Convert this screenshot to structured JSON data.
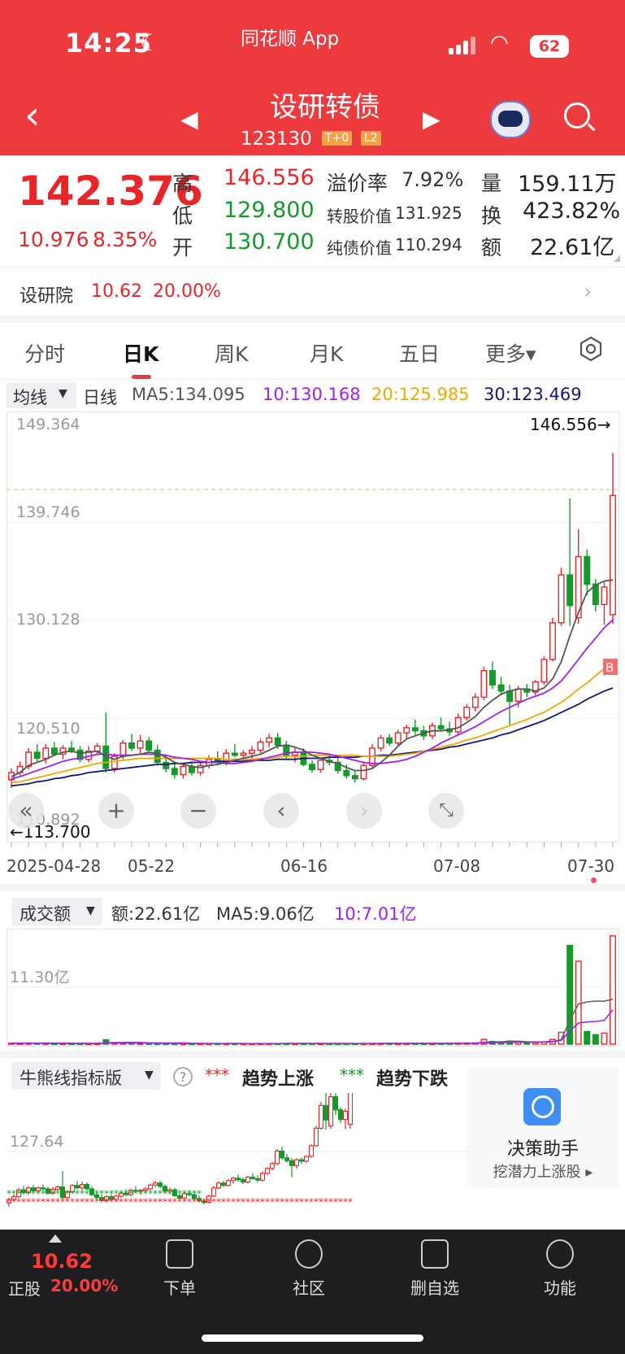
{
  "status_bar": {
    "time": "14:25",
    "app_name": "同花顺 App",
    "battery": "62"
  },
  "header": {
    "title": "设研转债",
    "code": "123130",
    "tag1": "T+0",
    "tag2": "L2"
  },
  "quote": {
    "price": "142.376",
    "change": "10.976",
    "change_pct": "8.35%",
    "high_label": "高",
    "high": "146.556",
    "low_label": "低",
    "low": "129.800",
    "open_label": "开",
    "open": "130.700",
    "premium_label": "溢价率",
    "premium": "7.92%",
    "conv_value_label": "转股价值",
    "conv_value": "131.925",
    "bond_value_label": "纯债价值",
    "bond_value": "110.294",
    "vol_label": "量",
    "vol": "159.11万",
    "turnover_label": "换",
    "turnover": "423.82%",
    "amount_label": "额",
    "amount": "22.61亿"
  },
  "related": {
    "name": "设研院",
    "price": "10.62",
    "pct": "20.00%"
  },
  "tabs": [
    {
      "label": "分时"
    },
    {
      "label": "日K"
    },
    {
      "label": "周K"
    },
    {
      "label": "月K"
    },
    {
      "label": "五日"
    },
    {
      "label": "更多▾"
    }
  ],
  "ma_row": {
    "button": "均线",
    "period": "日线",
    "ma5": "MA5:134.095",
    "ma10": "10:130.168",
    "ma20": "20:125.985",
    "ma30": "30:123.469",
    "colors": {
      "ma5": "#555555",
      "ma10": "#a020f0",
      "ma20": "#f0a800",
      "ma30": "#101880"
    }
  },
  "kchart_axis": {
    "y_ticks": [
      "149.364",
      "139.746",
      "130.128",
      "120.510",
      "110.892"
    ],
    "high_marker": "146.556→",
    "low_marker": "←113.700",
    "dates": [
      "2025-04-28",
      "05-22",
      "06-16",
      "07-08",
      "07-30"
    ],
    "b_marker": "B"
  },
  "volume": {
    "button": "成交额",
    "amount": "额:22.61亿",
    "ma5": "MA5:9.06亿",
    "ma10": "10:7.01亿",
    "y_tick": "11.30亿"
  },
  "indicator": {
    "button": "牛熊线指标版",
    "help": "?",
    "up_dots": "***",
    "up_label": "趋势上涨",
    "down_dots": "***",
    "down_label": "趋势下跌",
    "y_tick": "127.64"
  },
  "assistant": {
    "title": "决策助手",
    "subtitle": "挖潜力上涨股 ▸"
  },
  "bottom_bar": {
    "price": "10.62",
    "name": "正股",
    "pct": "20.00%",
    "items": [
      {
        "label": "下单"
      },
      {
        "label": "社区"
      },
      {
        "label": "删自选"
      },
      {
        "label": "功能"
      }
    ]
  },
  "chart_data": {
    "type": "candlestick",
    "ylim": [
      110.892,
      149.364
    ],
    "candles": [
      [
        114.5,
        115.6,
        113.7,
        115.2
      ],
      [
        115.2,
        116.3,
        114.9,
        115.8
      ],
      [
        115.8,
        117.6,
        115.5,
        117.2
      ],
      [
        117.2,
        118.0,
        116.3,
        116.6
      ],
      [
        116.6,
        118.0,
        116.1,
        117.6
      ],
      [
        117.6,
        118.2,
        116.9,
        117.0
      ],
      [
        117.0,
        117.9,
        116.5,
        117.6
      ],
      [
        117.6,
        118.3,
        117.1,
        117.4
      ],
      [
        117.4,
        117.8,
        116.2,
        116.5
      ],
      [
        116.5,
        117.8,
        116.2,
        117.3
      ],
      [
        117.3,
        118.1,
        116.9,
        117.8
      ],
      [
        117.8,
        121.1,
        115.2,
        115.6
      ],
      [
        115.6,
        117.1,
        115.2,
        116.8
      ],
      [
        116.8,
        118.4,
        116.5,
        118.1
      ],
      [
        118.1,
        119.0,
        117.3,
        117.6
      ],
      [
        117.6,
        118.9,
        117.0,
        118.3
      ],
      [
        118.3,
        118.7,
        117.2,
        117.4
      ],
      [
        117.4,
        117.9,
        115.9,
        116.2
      ],
      [
        116.2,
        116.9,
        115.2,
        115.6
      ],
      [
        115.6,
        116.3,
        114.6,
        115.0
      ],
      [
        115.0,
        116.1,
        114.6,
        115.8
      ],
      [
        115.8,
        116.3,
        114.9,
        115.2
      ],
      [
        115.2,
        116.2,
        114.9,
        115.9
      ],
      [
        115.9,
        116.9,
        115.6,
        116.5
      ],
      [
        116.5,
        117.3,
        115.9,
        116.2
      ],
      [
        116.2,
        117.5,
        115.9,
        117.1
      ],
      [
        117.1,
        118.0,
        116.7,
        116.9
      ],
      [
        116.9,
        117.4,
        116.2,
        117.1
      ],
      [
        117.1,
        117.8,
        116.5,
        117.4
      ],
      [
        117.4,
        118.5,
        117.1,
        118.2
      ],
      [
        118.2,
        119.0,
        117.7,
        118.6
      ],
      [
        118.6,
        119.1,
        117.5,
        117.9
      ],
      [
        117.9,
        118.3,
        116.6,
        116.9
      ],
      [
        116.9,
        117.6,
        116.2,
        117.2
      ],
      [
        117.2,
        117.6,
        115.8,
        116.0
      ],
      [
        116.0,
        116.4,
        115.2,
        115.5
      ],
      [
        115.5,
        116.7,
        115.2,
        116.4
      ],
      [
        116.4,
        117.1,
        115.9,
        116.2
      ],
      [
        116.2,
        116.6,
        115.1,
        115.4
      ],
      [
        115.4,
        116.0,
        114.6,
        114.9
      ],
      [
        114.9,
        115.4,
        114.2,
        114.6
      ],
      [
        114.6,
        116.2,
        114.4,
        115.9
      ],
      [
        115.9,
        118.0,
        115.7,
        117.6
      ],
      [
        117.6,
        118.9,
        117.3,
        118.6
      ],
      [
        118.6,
        119.0,
        117.8,
        118.1
      ],
      [
        118.1,
        119.4,
        117.9,
        119.1
      ],
      [
        119.1,
        119.9,
        118.5,
        119.6
      ],
      [
        119.6,
        120.4,
        118.9,
        119.3
      ],
      [
        119.3,
        119.8,
        118.4,
        118.8
      ],
      [
        118.8,
        120.1,
        118.5,
        119.8
      ],
      [
        119.8,
        120.6,
        119.3,
        119.5
      ],
      [
        119.5,
        120.2,
        118.8,
        119.2
      ],
      [
        119.2,
        121.0,
        118.9,
        120.6
      ],
      [
        120.6,
        121.9,
        120.3,
        121.6
      ],
      [
        121.6,
        123.0,
        121.2,
        122.6
      ],
      [
        122.6,
        125.6,
        122.3,
        125.2
      ],
      [
        125.2,
        126.1,
        123.4,
        123.8
      ],
      [
        123.8,
        124.6,
        122.8,
        123.2
      ],
      [
        123.2,
        123.8,
        119.8,
        122.2
      ],
      [
        122.2,
        123.7,
        121.6,
        123.4
      ],
      [
        123.4,
        123.9,
        122.6,
        123.1
      ],
      [
        123.1,
        124.3,
        122.8,
        124.1
      ],
      [
        124.1,
        126.6,
        123.8,
        126.3
      ],
      [
        126.3,
        130.4,
        126.1,
        129.9
      ],
      [
        129.9,
        135.3,
        129.6,
        134.6
      ],
      [
        134.6,
        142.1,
        129.6,
        131.6
      ],
      [
        130.4,
        139.1,
        129.8,
        136.4
      ],
      [
        136.4,
        137.1,
        132.6,
        133.7
      ],
      [
        133.7,
        134.2,
        131.0,
        131.7
      ],
      [
        131.7,
        133.9,
        129.7,
        133.4
      ],
      [
        130.7,
        146.6,
        129.8,
        142.4
      ]
    ],
    "ma5": [
      114.8,
      115.2,
      115.9,
      116.2,
      116.5,
      116.9,
      117.2,
      117.3,
      117.1,
      117.2,
      117.3,
      116.8,
      116.5,
      116.8,
      116.9,
      117.0,
      117.2,
      117.1,
      116.7,
      116.2,
      116.0,
      115.8,
      115.7,
      115.9,
      116.0,
      116.2,
      116.4,
      116.6,
      116.8,
      117.0,
      117.4,
      117.8,
      117.9,
      117.7,
      117.4,
      116.9,
      116.6,
      116.3,
      116.1,
      115.7,
      115.4,
      115.4,
      115.6,
      116.2,
      116.9,
      117.8,
      118.5,
      118.8,
      119.1,
      119.3,
      119.3,
      119.4,
      119.6,
      120.1,
      120.7,
      121.6,
      122.3,
      122.9,
      123.2,
      123.4,
      123.4,
      123.2,
      123.5,
      124.4,
      126.1,
      128.6,
      130.9,
      132.9,
      133.6,
      134.0,
      134.1
    ],
    "ma10": [
      114.6,
      114.8,
      115.1,
      115.4,
      115.7,
      116.0,
      116.3,
      116.5,
      116.6,
      116.8,
      117.0,
      117.0,
      116.9,
      116.9,
      116.9,
      117.0,
      117.0,
      117.0,
      116.9,
      116.7,
      116.6,
      116.5,
      116.3,
      116.2,
      116.2,
      116.1,
      116.1,
      116.2,
      116.3,
      116.5,
      116.7,
      116.9,
      117.1,
      117.2,
      117.2,
      117.2,
      117.1,
      117.0,
      116.8,
      116.6,
      116.4,
      116.2,
      116.1,
      116.1,
      116.2,
      116.3,
      116.5,
      116.8,
      117.2,
      117.6,
      118.1,
      118.5,
      118.9,
      119.3,
      119.7,
      120.2,
      120.7,
      121.2,
      121.6,
      122.0,
      122.4,
      122.7,
      123.0,
      123.5,
      124.2,
      125.2,
      126.3,
      127.4,
      128.4,
      129.4,
      130.2
    ],
    "ma20": [
      114.2,
      114.3,
      114.5,
      114.7,
      114.9,
      115.1,
      115.3,
      115.5,
      115.7,
      115.9,
      116.1,
      116.2,
      116.3,
      116.4,
      116.5,
      116.6,
      116.6,
      116.6,
      116.6,
      116.6,
      116.6,
      116.6,
      116.6,
      116.6,
      116.6,
      116.5,
      116.5,
      116.5,
      116.5,
      116.6,
      116.6,
      116.7,
      116.8,
      116.8,
      116.8,
      116.9,
      116.9,
      116.9,
      116.9,
      116.9,
      116.9,
      116.8,
      116.8,
      116.8,
      116.8,
      116.9,
      117.0,
      117.1,
      117.3,
      117.5,
      117.7,
      117.9,
      118.1,
      118.4,
      118.6,
      118.9,
      119.2,
      119.5,
      119.8,
      120.1,
      120.4,
      120.8,
      121.1,
      121.6,
      122.1,
      122.7,
      123.4,
      124.0,
      124.7,
      125.4,
      126.0
    ],
    "ma30": [
      113.9,
      114.0,
      114.1,
      114.3,
      114.4,
      114.6,
      114.7,
      114.9,
      115.0,
      115.2,
      115.3,
      115.4,
      115.5,
      115.6,
      115.7,
      115.8,
      115.9,
      116.0,
      116.0,
      116.1,
      116.1,
      116.2,
      116.2,
      116.2,
      116.3,
      116.3,
      116.3,
      116.3,
      116.4,
      116.4,
      116.4,
      116.5,
      116.5,
      116.5,
      116.6,
      116.6,
      116.6,
      116.7,
      116.7,
      116.7,
      116.7,
      116.8,
      116.8,
      116.9,
      116.9,
      117.0,
      117.1,
      117.2,
      117.3,
      117.4,
      117.5,
      117.7,
      117.8,
      118.0,
      118.2,
      118.4,
      118.6,
      118.9,
      119.1,
      119.4,
      119.7,
      120.0,
      120.3,
      120.7,
      121.1,
      121.5,
      121.9,
      122.4,
      122.8,
      123.2,
      123.5
    ],
    "volume": [
      0.12,
      0.1,
      0.15,
      0.12,
      0.1,
      0.08,
      0.09,
      0.08,
      0.07,
      0.08,
      0.09,
      0.55,
      0.2,
      0.15,
      0.12,
      0.1,
      0.1,
      0.09,
      0.08,
      0.08,
      0.07,
      0.07,
      0.07,
      0.08,
      0.08,
      0.08,
      0.08,
      0.07,
      0.07,
      0.08,
      0.08,
      0.08,
      0.08,
      0.08,
      0.09,
      0.08,
      0.08,
      0.07,
      0.07,
      0.08,
      0.08,
      0.08,
      0.09,
      0.1,
      0.1,
      0.09,
      0.1,
      0.1,
      0.09,
      0.09,
      0.1,
      0.1,
      0.12,
      0.14,
      0.16,
      0.6,
      0.35,
      0.3,
      0.4,
      0.25,
      0.22,
      0.2,
      0.3,
      0.6,
      1.5,
      12.5,
      10.5,
      1.6,
      1.2,
      1.4,
      13.7
    ],
    "vol_ylim": [
      0,
      14
    ]
  }
}
